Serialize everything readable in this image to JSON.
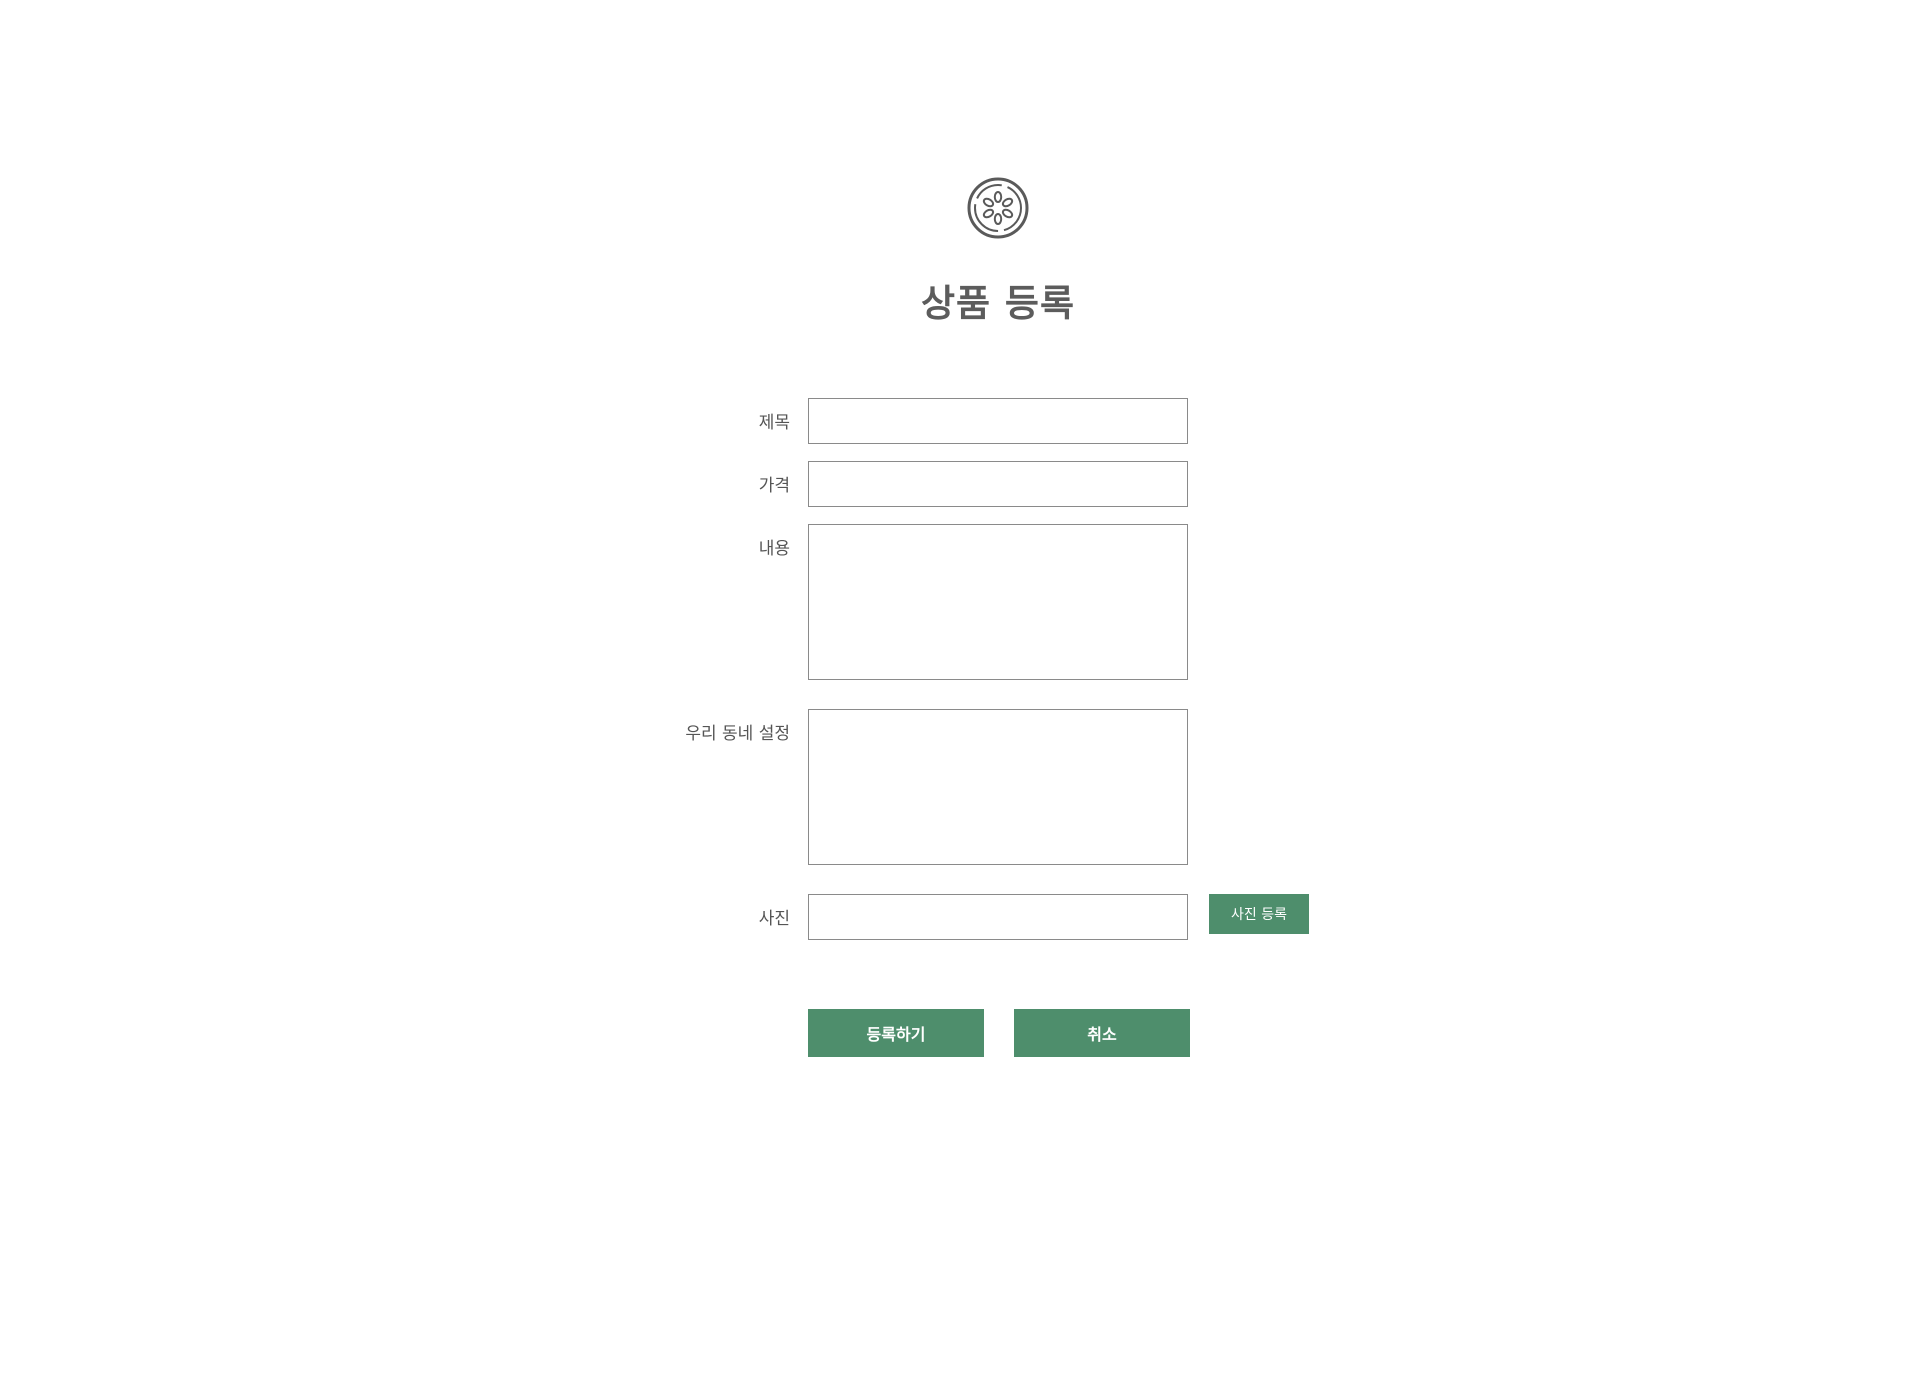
{
  "header": {
    "logo_icon": "seed-flower-icon",
    "title": "상품 등록"
  },
  "form": {
    "title_label": "제목",
    "title_value": "",
    "price_label": "가격",
    "price_value": "",
    "content_label": "내용",
    "content_value": "",
    "neighborhood_label": "우리 동네 설정",
    "neighborhood_value": "",
    "photo_label": "사진",
    "photo_value": "",
    "photo_button": "사진 등록"
  },
  "actions": {
    "submit_label": "등록하기",
    "cancel_label": "취소"
  },
  "colors": {
    "accent": "#4e8e6c",
    "text": "#555555",
    "border": "#8a8a8a"
  }
}
